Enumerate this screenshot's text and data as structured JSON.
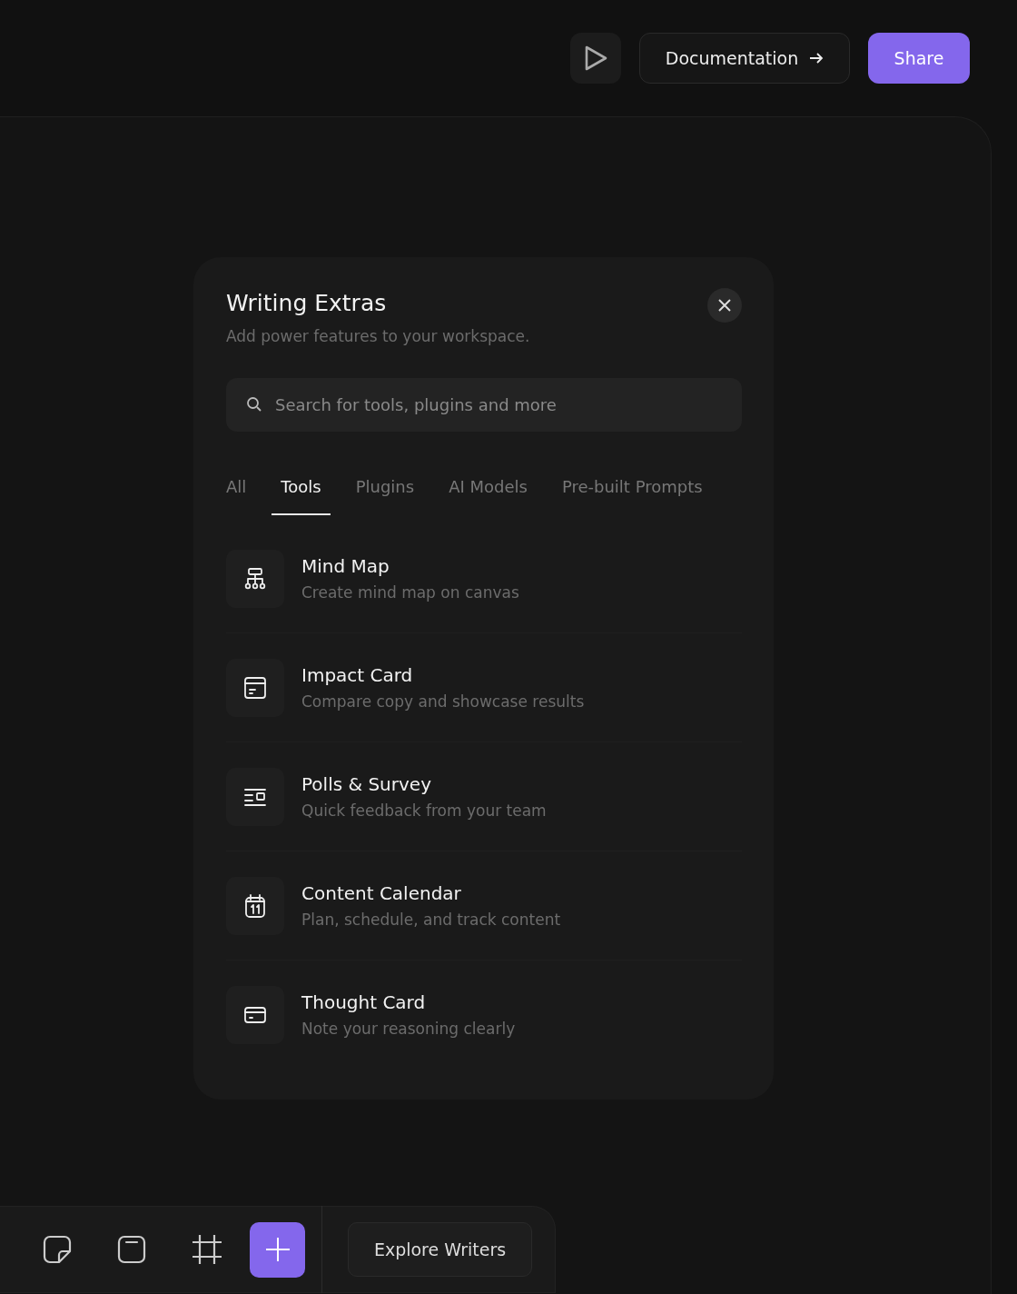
{
  "header": {
    "documentation": "Documentation",
    "share": "Share"
  },
  "modal": {
    "title": "Writing Extras",
    "subtitle": "Add power features to your workspace.",
    "search": {
      "placeholder": "Search for tools, plugins and more"
    },
    "tabs": [
      {
        "label": "All",
        "selected": false
      },
      {
        "label": "Tools",
        "selected": true
      },
      {
        "label": "Plugins",
        "selected": false
      },
      {
        "label": "AI Models",
        "selected": false
      },
      {
        "label": "Pre-built Prompts",
        "selected": false
      }
    ],
    "items": [
      {
        "title": "Mind Map",
        "description": "Create mind map on canvas"
      },
      {
        "title": "Impact Card",
        "description": "Compare copy and showcase results"
      },
      {
        "title": "Polls & Survey",
        "description": "Quick feedback from your team"
      },
      {
        "title": "Content Calendar",
        "description": "Plan, schedule, and track content"
      },
      {
        "title": "Thought Card",
        "description": "Note your reasoning clearly"
      }
    ]
  },
  "toolbar": {
    "explore": "Explore Writers"
  }
}
